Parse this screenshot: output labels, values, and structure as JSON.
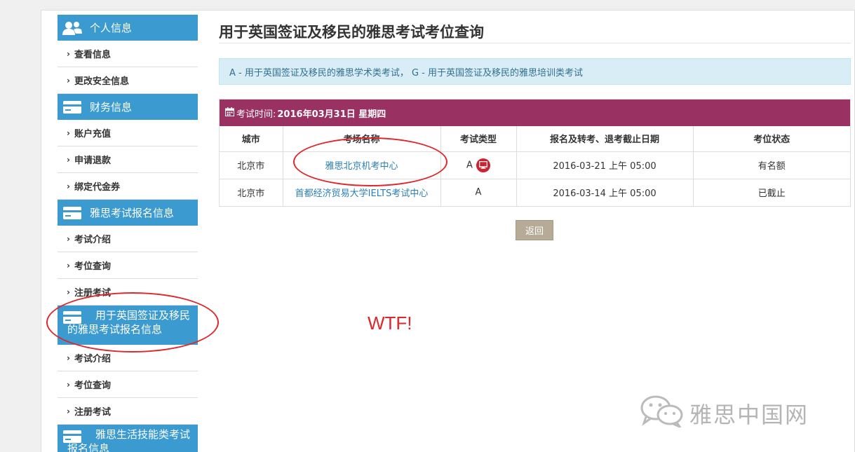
{
  "sidebar": {
    "sections": [
      {
        "title": "个人信息",
        "icon": "users-icon",
        "items": [
          "查看信息",
          "更改安全信息"
        ]
      },
      {
        "title": "财务信息",
        "icon": "card-icon",
        "items": [
          "账户充值",
          "申请退款",
          "绑定代金券"
        ]
      },
      {
        "title": "雅思考试报名信息",
        "icon": "card-icon",
        "items": [
          "考试介绍",
          "考位查询",
          "注册考试"
        ]
      },
      {
        "title": "用于英国签证及移民的雅思考试报名信息",
        "icon": "card-icon",
        "items": [
          "考试介绍",
          "考位查询",
          "注册考试"
        ]
      },
      {
        "title": "雅思生活技能类考试报名信息",
        "icon": "card-icon",
        "items": []
      }
    ]
  },
  "main": {
    "title": "用于英国签证及移民的雅思考试考位查询",
    "info": "A - 用于英国签证及移民的雅思学术类考试， G - 用于英国签证及移民的雅思培训类考试",
    "panel": {
      "label": "考试时间:",
      "date": "2016年03月31日 星期四"
    },
    "table": {
      "headers": [
        "城市",
        "考场名称",
        "考试类型",
        "报名及转考、退考截止日期",
        "考位状态"
      ],
      "rows": [
        {
          "city": "北京市",
          "venue": "雅思北京机考中心",
          "type": "A",
          "computer": true,
          "deadline": "2016-03-21 上午 05:00",
          "status": "有名额"
        },
        {
          "city": "北京市",
          "venue": "首都经济贸易大学IELTS考试中心",
          "type": "A",
          "computer": false,
          "deadline": "2016-03-14 上午 05:00",
          "status": "已截止"
        }
      ]
    },
    "back_label": "返回"
  },
  "annotation": {
    "text": "WTF!",
    "color": "#e0262a"
  },
  "watermark": {
    "text": "雅思中国网"
  },
  "colors": {
    "sidebar_header": "#3b9bd1",
    "panel_header": "#9a3163",
    "info_bg": "#d9edf7",
    "button": "#b5ab97"
  }
}
